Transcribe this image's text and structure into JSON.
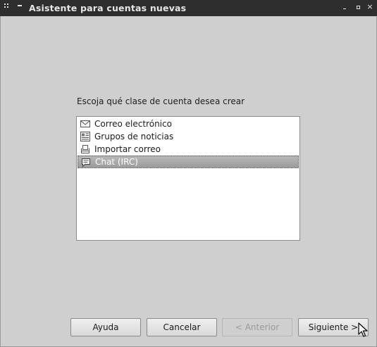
{
  "window": {
    "title": "Asistente para cuentas nuevas"
  },
  "prompt": "Escoja qué clase de cuenta desea crear",
  "account_types": [
    {
      "label": "Correo electrónico",
      "icon": "envelope-icon",
      "selected": false
    },
    {
      "label": "Grupos de noticias",
      "icon": "newspaper-icon",
      "selected": false
    },
    {
      "label": "Importar correo",
      "icon": "import-mail-icon",
      "selected": false
    },
    {
      "label": "Chat (IRC)",
      "icon": "chat-bubble-icon",
      "selected": true
    }
  ],
  "buttons": {
    "help": "Ayuda",
    "cancel": "Cancelar",
    "previous": "< Anterior",
    "next": "Siguiente >"
  },
  "colors": {
    "titlebar": "#2e2e2e",
    "background": "#cfcfcf",
    "selection": "#a8a8a8"
  }
}
